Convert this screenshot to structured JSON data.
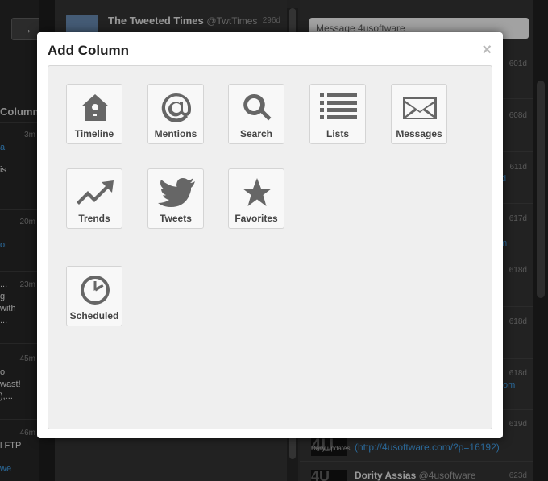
{
  "background": {
    "left_column": {
      "arrow": "→",
      "title": "Column",
      "entries": [
        {
          "time": "3m",
          "lines": [
            "a",
            "is"
          ]
        },
        {
          "time": "20m",
          "lines": [
            "ot"
          ]
        },
        {
          "time": "23m",
          "lines": [
            "...",
            "g",
            "with",
            "..."
          ]
        },
        {
          "time": "45m",
          "lines": [
            "o",
            "wast!",
            "),..."
          ]
        },
        {
          "time": "46m",
          "lines": [
            "l FTP",
            "we"
          ]
        }
      ]
    },
    "middle_column": {
      "name": "The Tweeted Times",
      "handle": "@TwtTimes",
      "time": "296d"
    },
    "right_column": {
      "message_placeholder": "Message 4usoftware",
      "times": [
        "601d",
        "608d",
        "611d",
        "617d",
        "618d",
        "618d",
        "618d",
        "619d",
        "623d"
      ],
      "link_fragment_1": "d",
      "link_fragment_2": "m",
      "link_fragment_3": "om",
      "entry_link": "(http://4usoftware.com/?p=16192)",
      "thumb_text": "4U",
      "thumb_caption": "Daily updates",
      "entry_name": "Dority Assias",
      "entry_handle": "@4usoftware"
    }
  },
  "modal": {
    "title": "Add Column",
    "close": "×",
    "tiles": [
      {
        "label": "Timeline",
        "icon": "house-icon"
      },
      {
        "label": "Mentions",
        "icon": "at-icon"
      },
      {
        "label": "Search",
        "icon": "magnifier-icon"
      },
      {
        "label": "Lists",
        "icon": "list-icon"
      },
      {
        "label": "Messages",
        "icon": "envelope-icon"
      },
      {
        "label": "Trends",
        "icon": "trend-arrow-icon"
      },
      {
        "label": "Tweets",
        "icon": "bird-icon"
      },
      {
        "label": "Favorites",
        "icon": "star-icon"
      },
      {
        "label": "Scheduled",
        "icon": "clock-icon"
      }
    ]
  },
  "colors": {
    "accent_link": "#3a8ecf",
    "icon_gray": "#666666",
    "panel_bg": "#efefef"
  }
}
